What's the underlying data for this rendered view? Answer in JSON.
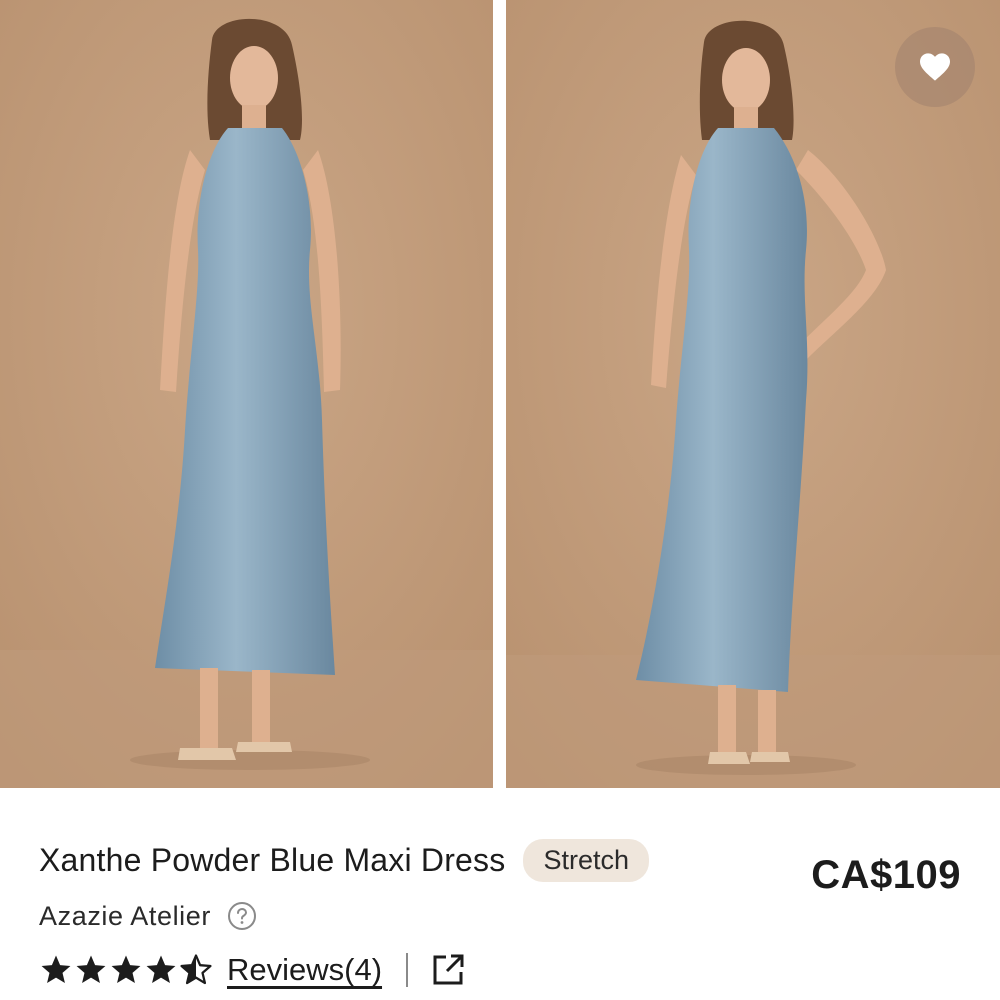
{
  "product": {
    "title": "Xanthe Powder Blue Maxi Dress",
    "tag": "Stretch",
    "price": "CA$109",
    "brand": "Azazie Atelier",
    "rating": 4.5,
    "reviews_label": "Reviews(4)"
  },
  "icons": {
    "favorite": "heart-icon",
    "help": "question-circle-icon",
    "share": "external-link-icon",
    "rating": "star-icon"
  },
  "colors": {
    "backdrop": "#c4a080",
    "dress": "#7d9db3",
    "badge_bg": "#efe6dc",
    "text": "#1c1c1c"
  }
}
